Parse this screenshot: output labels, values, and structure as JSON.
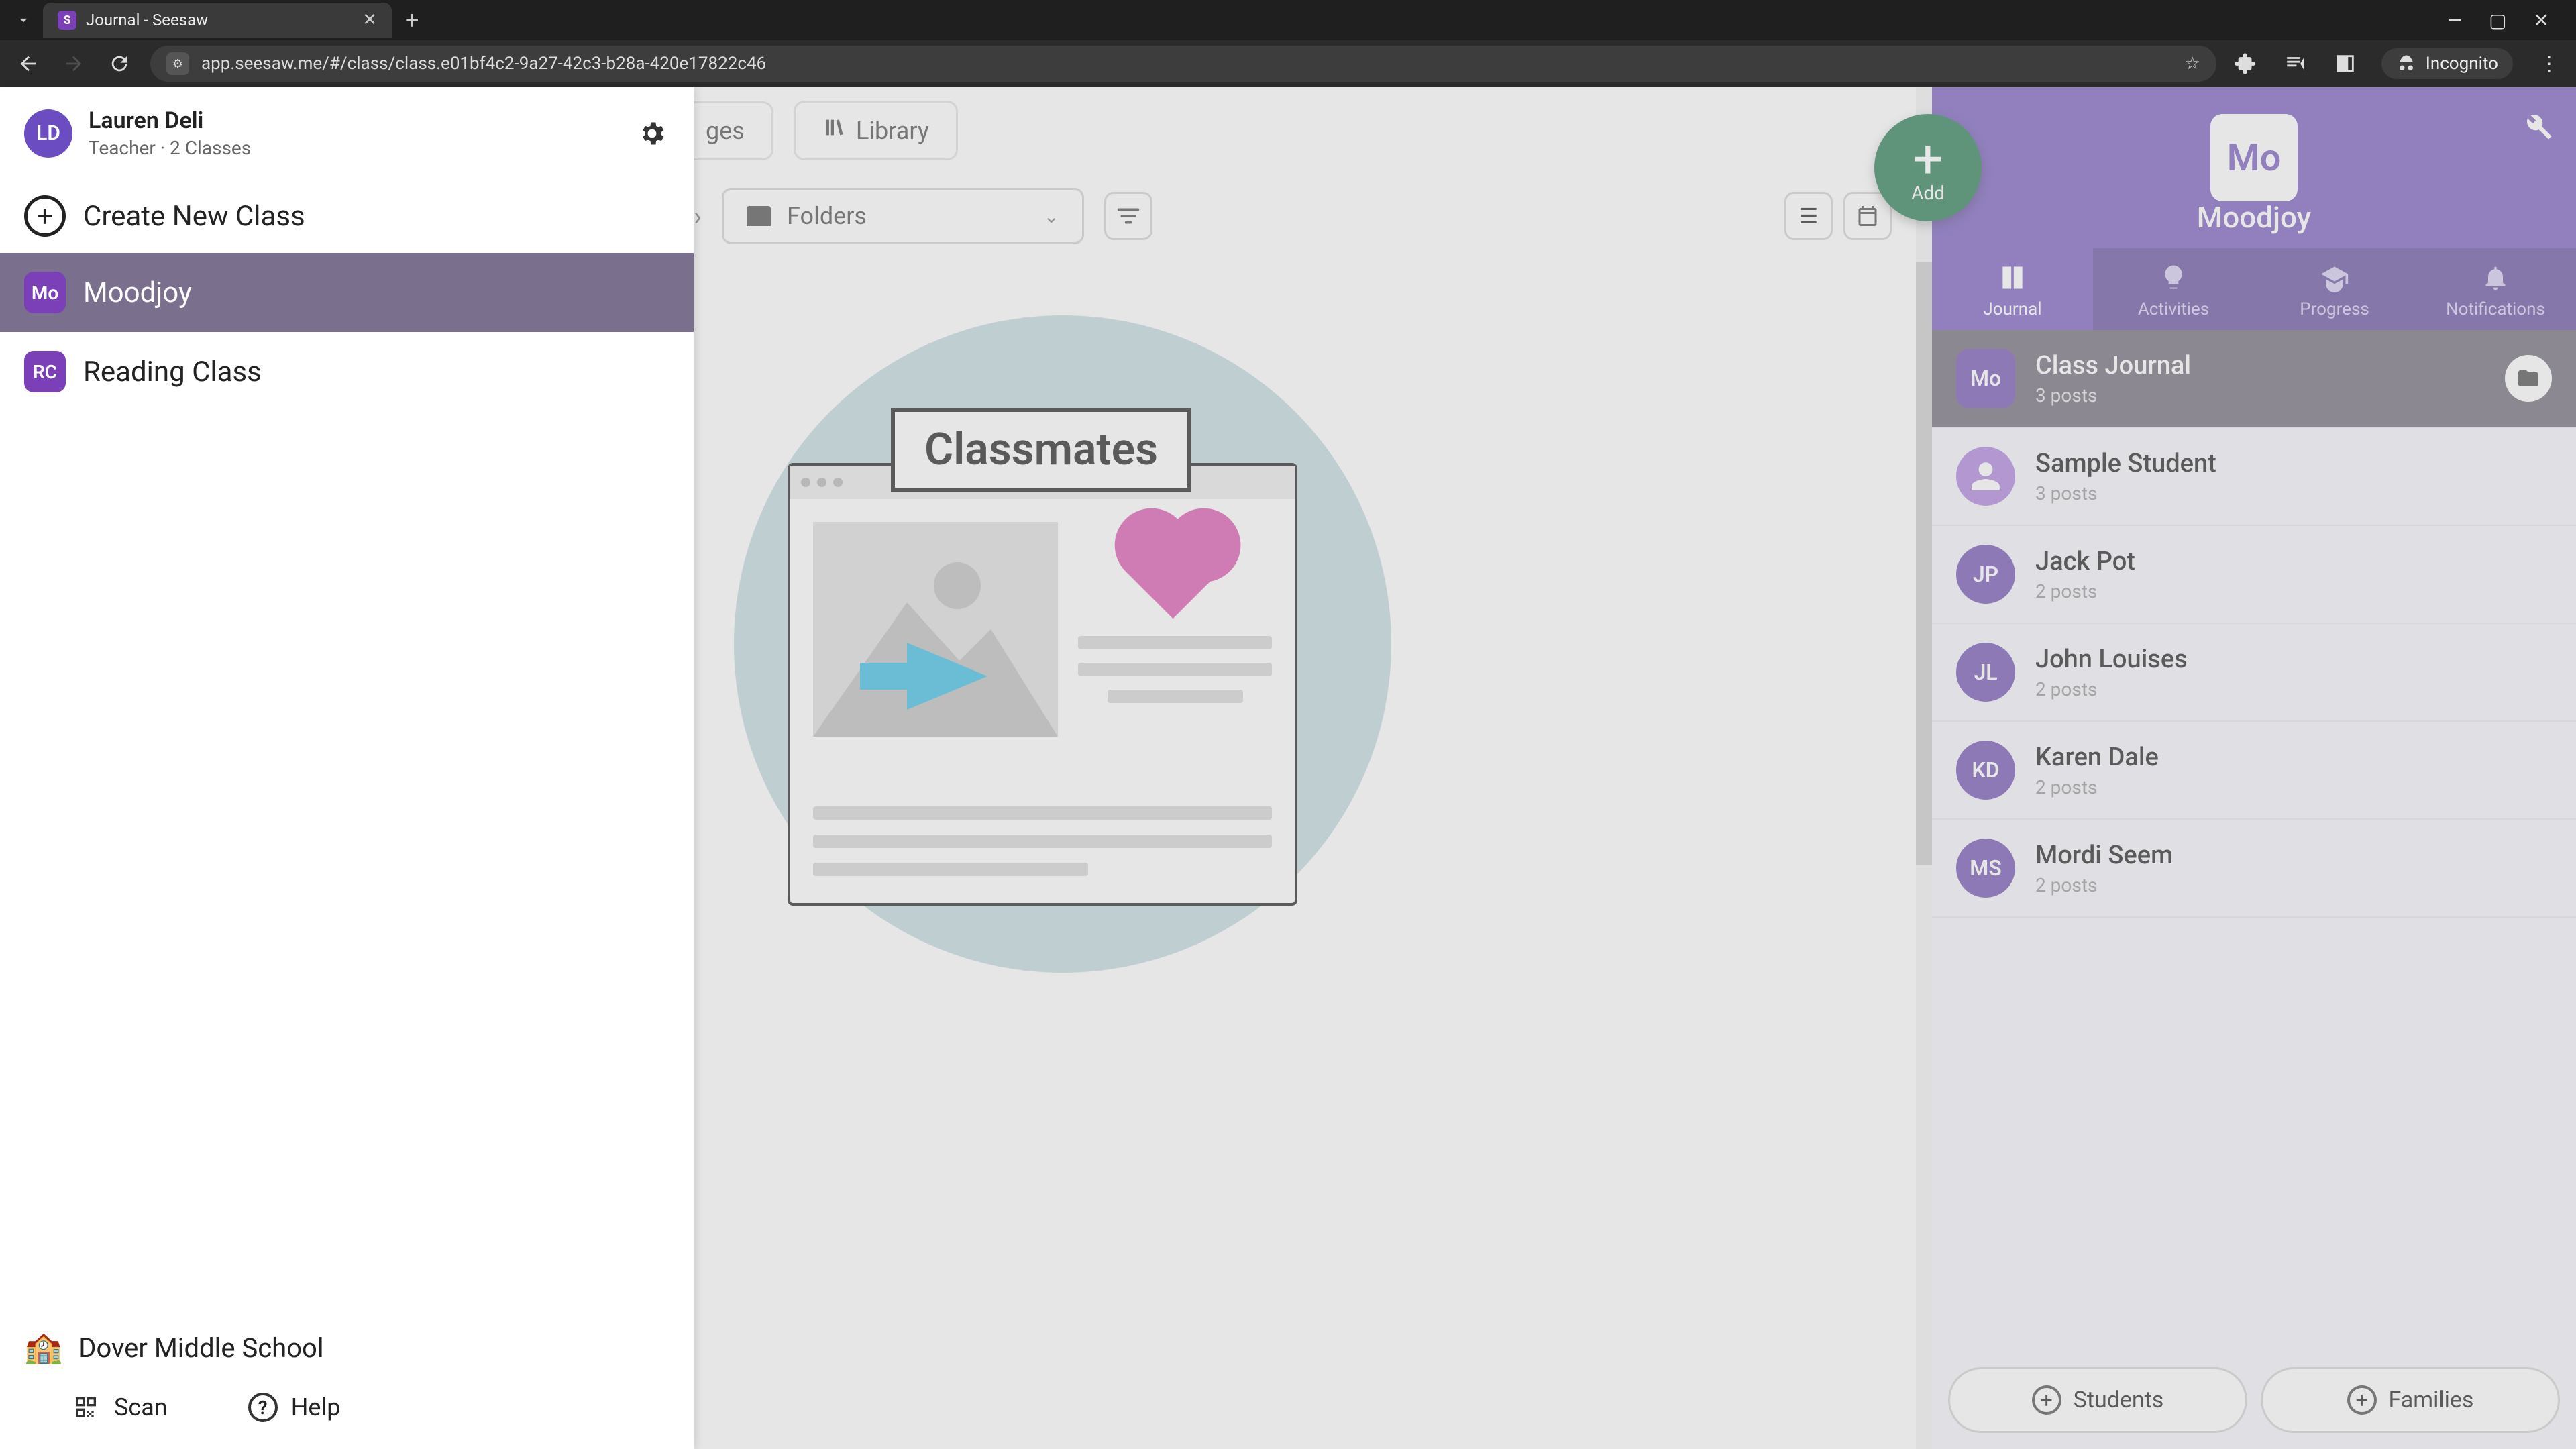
{
  "browser": {
    "tab_title": "Journal - Seesaw",
    "url": "app.seesaw.me/#/class/class.e01bf4c2-9a27-42c3-b28a-420e17822c46",
    "incognito_label": "Incognito"
  },
  "drawer": {
    "user": {
      "initials": "LD",
      "name": "Lauren Deli",
      "role": "Teacher · 2 Classes"
    },
    "create_label": "Create New Class",
    "classes": [
      {
        "badge": "Mo",
        "name": "Moodjoy",
        "active": true
      },
      {
        "badge": "RC",
        "name": "Reading Class",
        "active": false
      }
    ],
    "school": "Dover Middle School",
    "scan_label": "Scan",
    "help_label": "Help"
  },
  "center": {
    "tab_partial": "ges",
    "library_label": "Library",
    "folders_label": "Folders",
    "hero_label": "Classmates"
  },
  "right": {
    "add_label": "Add",
    "class_badge": "Mo",
    "class_name": "Moodjoy",
    "tabs": [
      {
        "key": "journal",
        "label": "Journal",
        "active": true
      },
      {
        "key": "activities",
        "label": "Activities",
        "active": false
      },
      {
        "key": "progress",
        "label": "Progress",
        "active": false
      },
      {
        "key": "notifications",
        "label": "Notifications",
        "active": false
      }
    ],
    "journal_rows": [
      {
        "avatar": "Mo",
        "avatar_shape": "square",
        "name": "Class Journal",
        "posts": "3 posts",
        "selected": true,
        "has_folder": true
      },
      {
        "avatar": "👤",
        "avatar_color": "#8a5fc9",
        "name": "Sample Student",
        "posts": "3 posts"
      },
      {
        "avatar": "JP",
        "name": "Jack Pot",
        "posts": "2 posts"
      },
      {
        "avatar": "JL",
        "name": "John Louises",
        "posts": "2 posts"
      },
      {
        "avatar": "KD",
        "name": "Karen Dale",
        "posts": "2 posts"
      },
      {
        "avatar": "MS",
        "name": "Mordi Seem",
        "posts": "2 posts"
      }
    ],
    "students_btn": "Students",
    "families_btn": "Families"
  }
}
